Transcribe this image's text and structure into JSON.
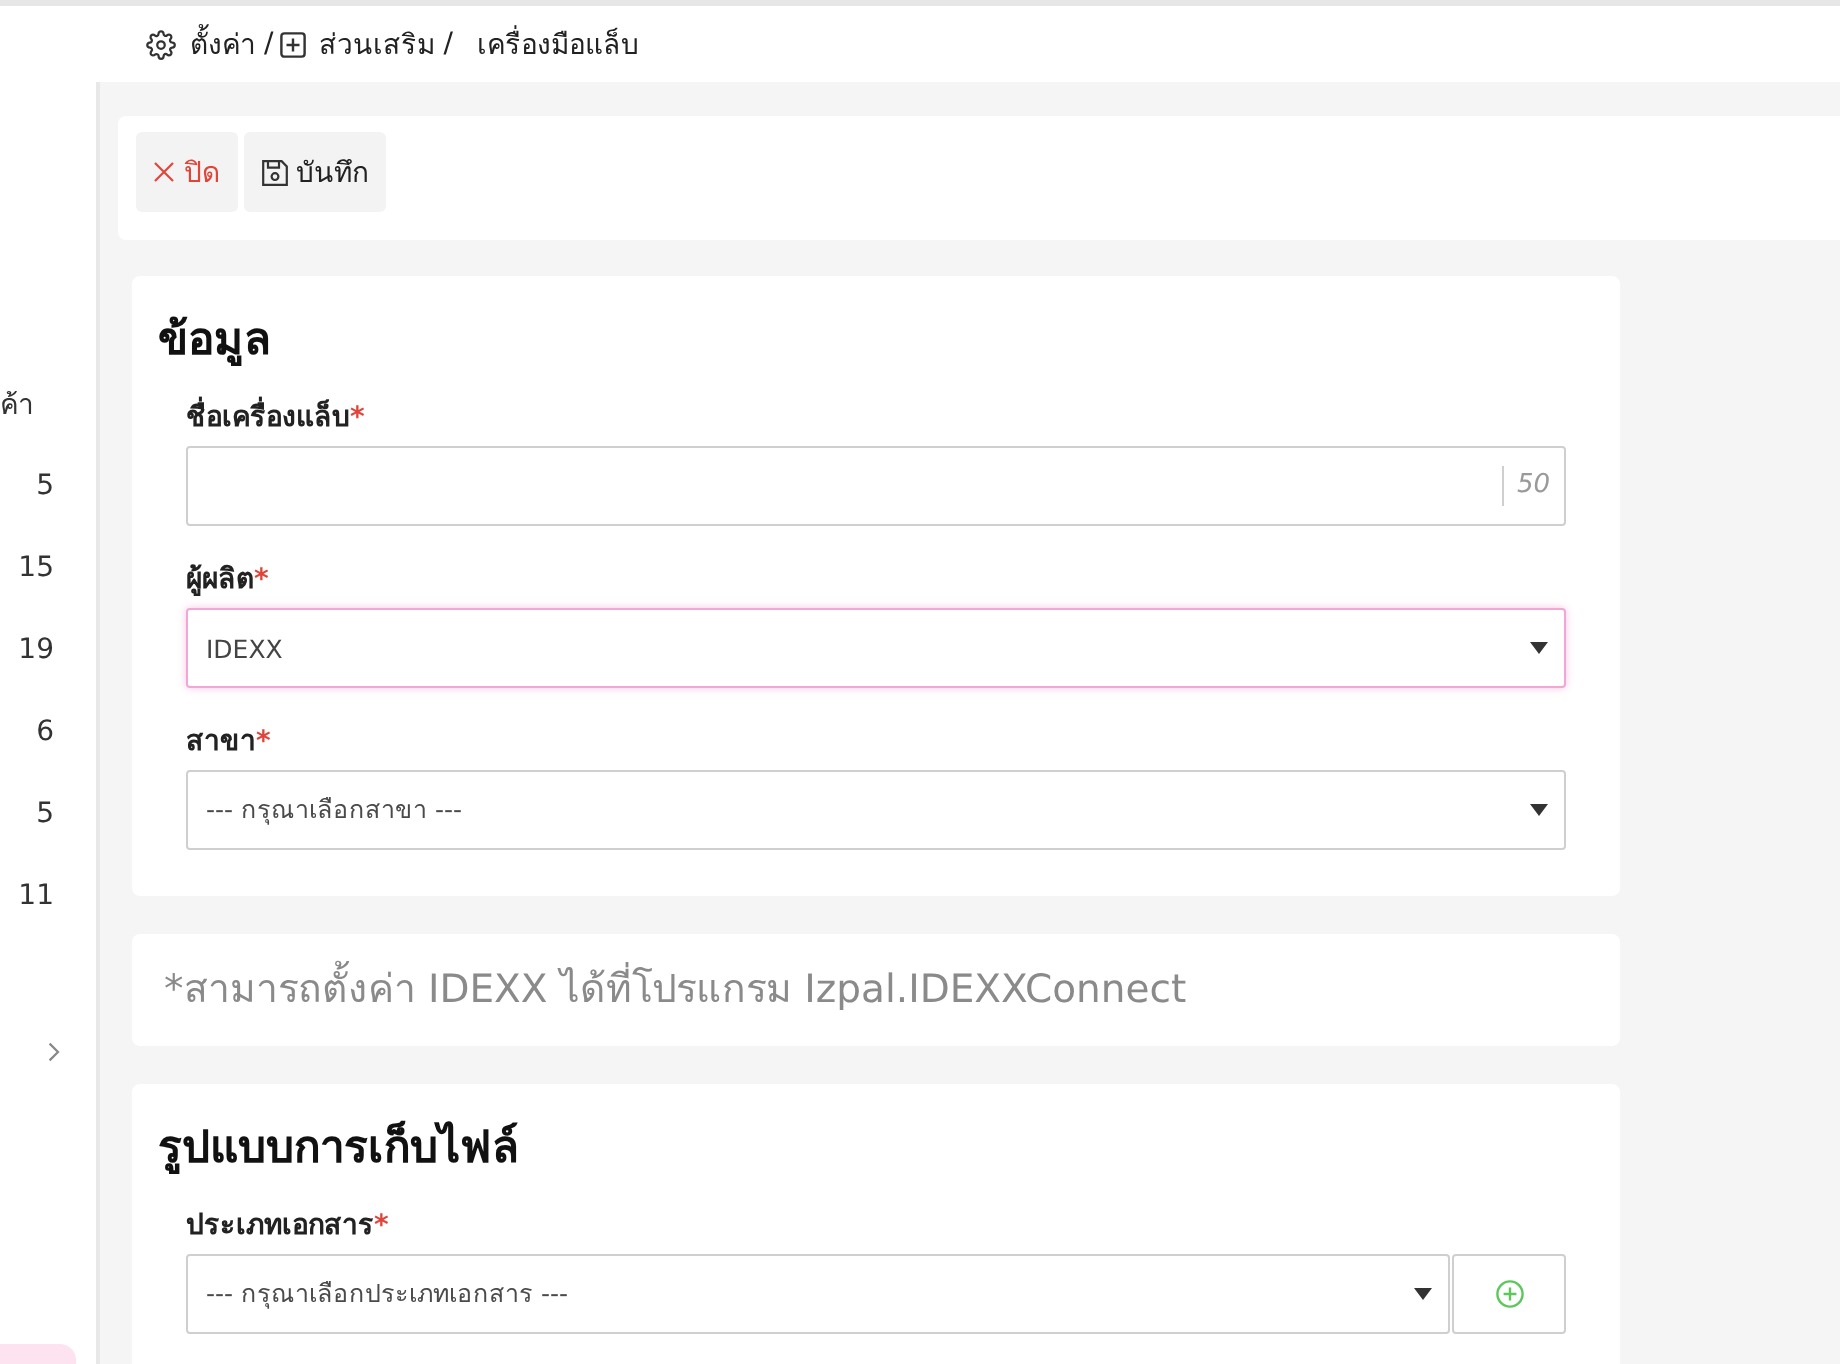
{
  "breadcrumb": [
    {
      "kind": "settings",
      "label": "ตั้งค่า",
      "separator": "/"
    },
    {
      "kind": "addons",
      "label": "ส่วนเสริม",
      "separator": "/"
    },
    {
      "kind": "current",
      "label": "เครื่องมือแล็บ"
    }
  ],
  "sidebar": {
    "label": "ค้า",
    "counts": [
      "5",
      "15",
      "19",
      "6",
      "5",
      "11"
    ]
  },
  "toolbar": {
    "buttons": [
      {
        "kind": "close",
        "label": "ปิด"
      },
      {
        "kind": "save",
        "label": "บันทึก"
      }
    ]
  },
  "sections": [
    {
      "kind": "form",
      "title": "ข้อมูล",
      "fields": [
        {
          "kind": "text",
          "label": "ชื่อเครื่องแล็บ",
          "required_mark": "*",
          "counter": "50"
        },
        {
          "kind": "select",
          "label": "ผู้ผลิต",
          "required_mark": "*",
          "value": "IDEXX",
          "focused": true
        },
        {
          "kind": "select",
          "label": "สาขา",
          "required_mark": "*",
          "placeholder": "--- กรุณาเลือกสาขา ---",
          "focused": false
        }
      ]
    },
    {
      "kind": "note",
      "text": "*สามารถตั้งค่า IDEXX ได้ที่โปรแกรม Izpal.IDEXXConnect"
    },
    {
      "kind": "form",
      "title": "รูปแบบการเก็บไฟล์",
      "fields": [
        {
          "kind": "select-add",
          "label": "ประเภทเอกสาร",
          "required_mark": "*",
          "placeholder": "--- กรุณาเลือกประเภทเอกสาร ---",
          "focused": false
        }
      ]
    }
  ]
}
